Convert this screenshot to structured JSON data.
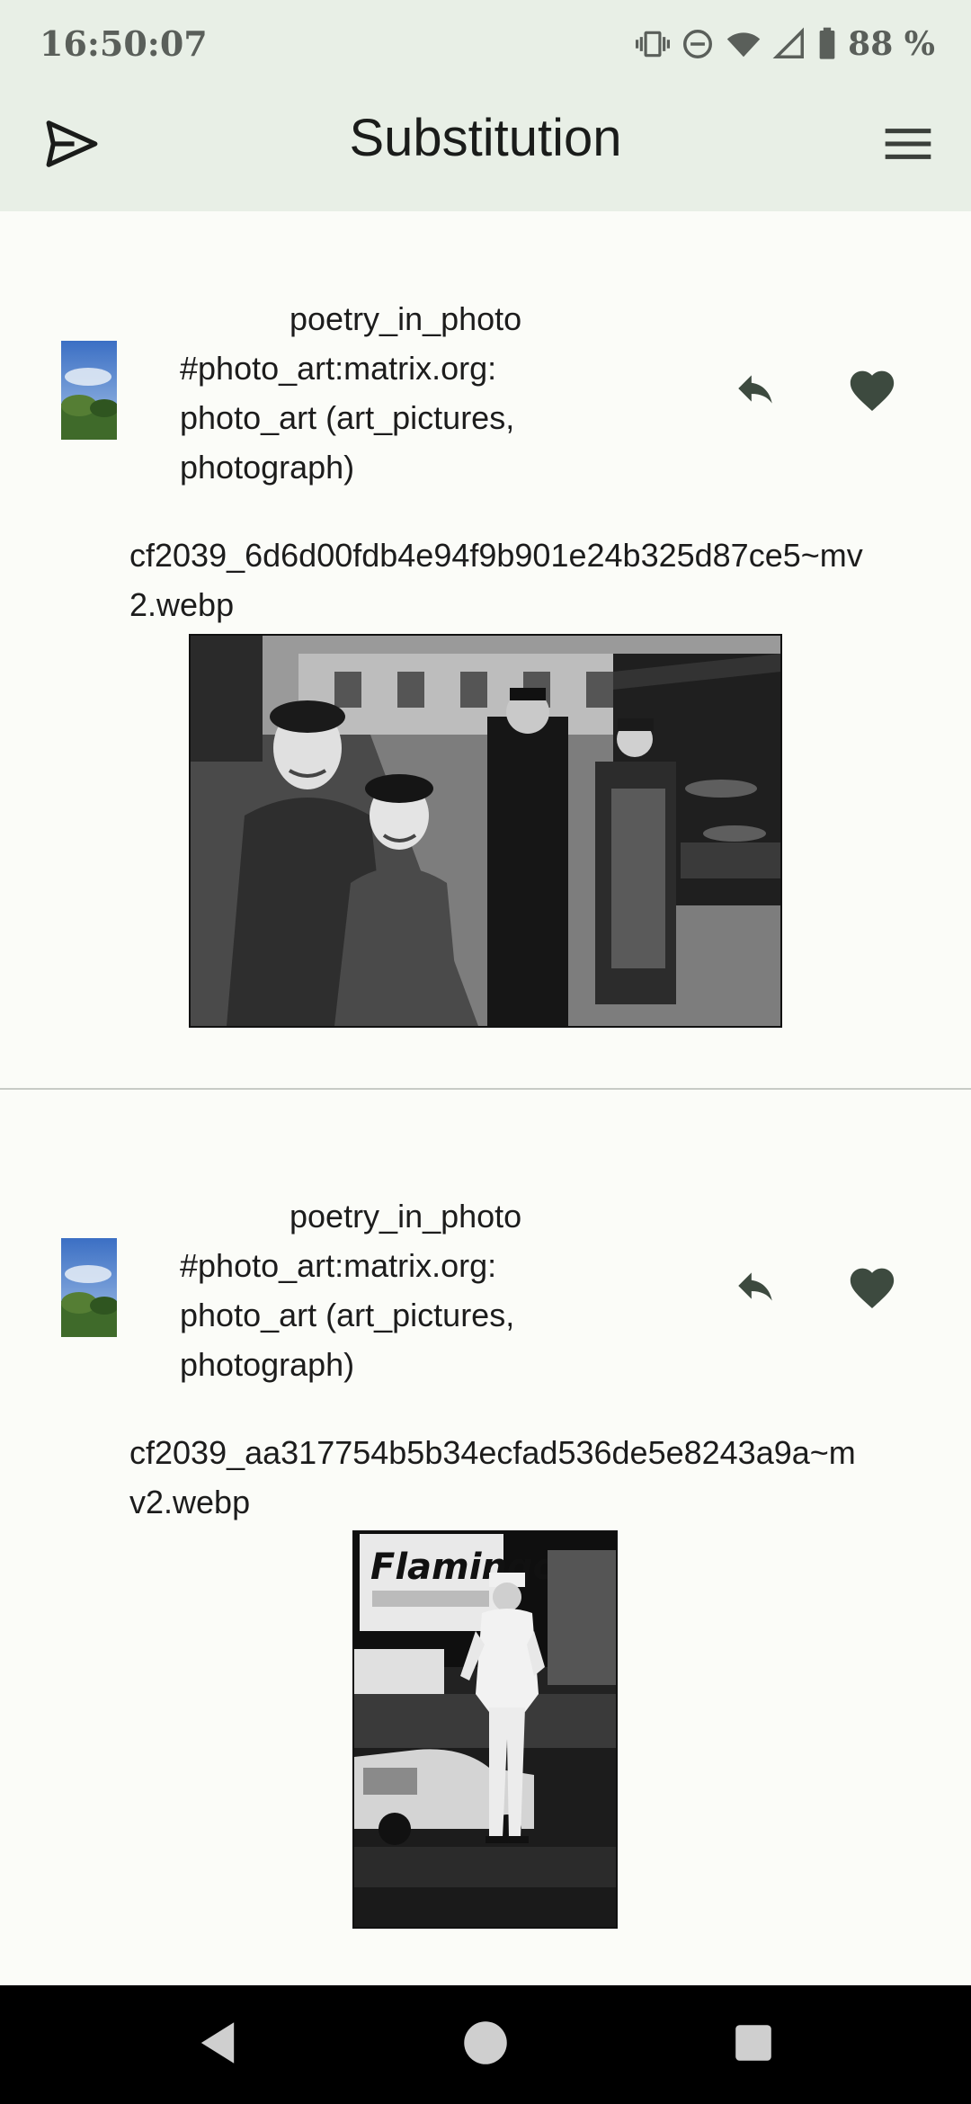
{
  "status_bar": {
    "time": "16:50:07",
    "battery_percent": "88 %",
    "icons": [
      "vibrate-icon",
      "do-not-disturb-icon",
      "wifi-icon",
      "signal-icon",
      "battery-icon"
    ]
  },
  "app_bar": {
    "title": "Substitution",
    "left_icon": "send-icon",
    "right_icon": "menu-icon"
  },
  "posts": [
    {
      "sender_line1": "poetry_in_photo",
      "sender_line2": "#photo_art:matrix.org:",
      "sender_line3": "photo_art (art_pictures,",
      "sender_line4": "photograph)",
      "filename": "cf2039_6d6d00fdb4e94f9b901e24b325d87ce5~mv2.webp",
      "reply_icon": "reply-icon",
      "like_icon": "heart-icon"
    },
    {
      "sender_line1": "poetry_in_photo",
      "sender_line2": "#photo_art:matrix.org:",
      "sender_line3": "photo_art (art_pictures,",
      "sender_line4": "photograph)",
      "filename": "cf2039_aa317754b5b34ecfad536de5e8243a9a~mv2.webp",
      "reply_icon": "reply-icon",
      "like_icon": "heart-icon",
      "photo_sign_text": "Flamingo"
    }
  ],
  "colors": {
    "app_bar_bg": "#e8efe6",
    "content_bg": "#fbfcf8",
    "icon_color": "#3d4a3f",
    "nav_bg": "#000000"
  }
}
